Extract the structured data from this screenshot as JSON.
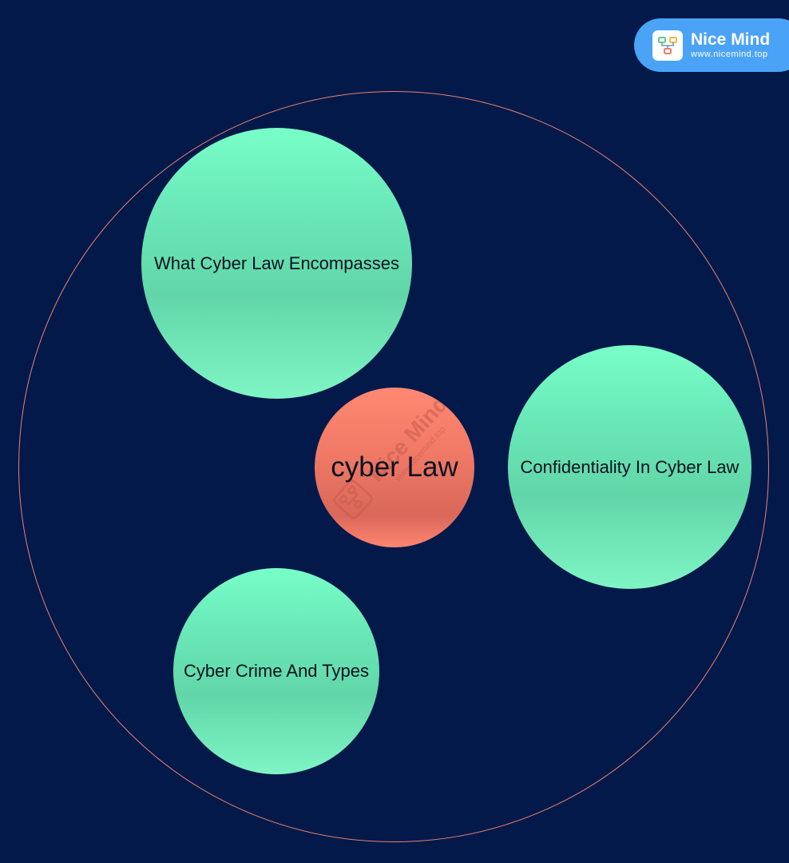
{
  "diagram": {
    "center": {
      "label": "cyber Law"
    },
    "topics": [
      {
        "label": "What Cyber Law Encompasses"
      },
      {
        "label": "Confidentiality In Cyber Law"
      },
      {
        "label": "Cyber Crime And Types"
      }
    ]
  },
  "watermark": {
    "title": "Nice Mind",
    "url": "www.nicemind.top"
  },
  "brand": {
    "title": "Nice Mind",
    "url": "www.nicemind.top",
    "logo_icon": "mindmap-logo-icon"
  },
  "colors": {
    "background": "#03194a",
    "ring": "#e8826e",
    "topic_fill": "#6ae8b8",
    "center_fill": "#f07a66",
    "brand_badge": "#4aa3f7"
  }
}
